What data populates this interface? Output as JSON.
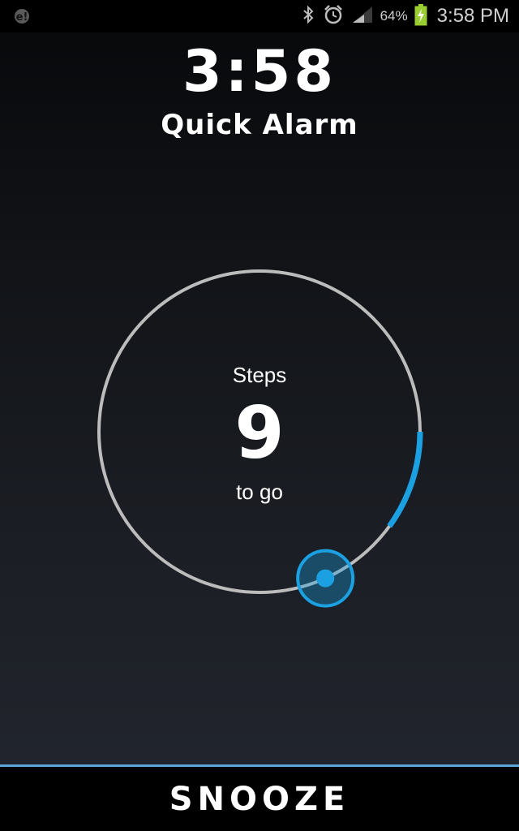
{
  "status_bar": {
    "left_icon": "notification-alert-icon",
    "icons": [
      "bluetooth-icon",
      "alarm-clock-icon",
      "signal-icon",
      "battery-charging-icon"
    ],
    "battery_percent": "64%",
    "time": "3:58 PM"
  },
  "header": {
    "clock": "3:58",
    "alarm_name": "Quick Alarm"
  },
  "dial": {
    "steps_label": "Steps",
    "steps_remaining": "9",
    "togo_label": "to go",
    "progress_fraction": 0.1,
    "ring_color": "#bcbcbc",
    "progress_color": "#1ba1e2"
  },
  "snooze": {
    "label": "SNOOZE",
    "accent_color": "#5aa6d6"
  }
}
